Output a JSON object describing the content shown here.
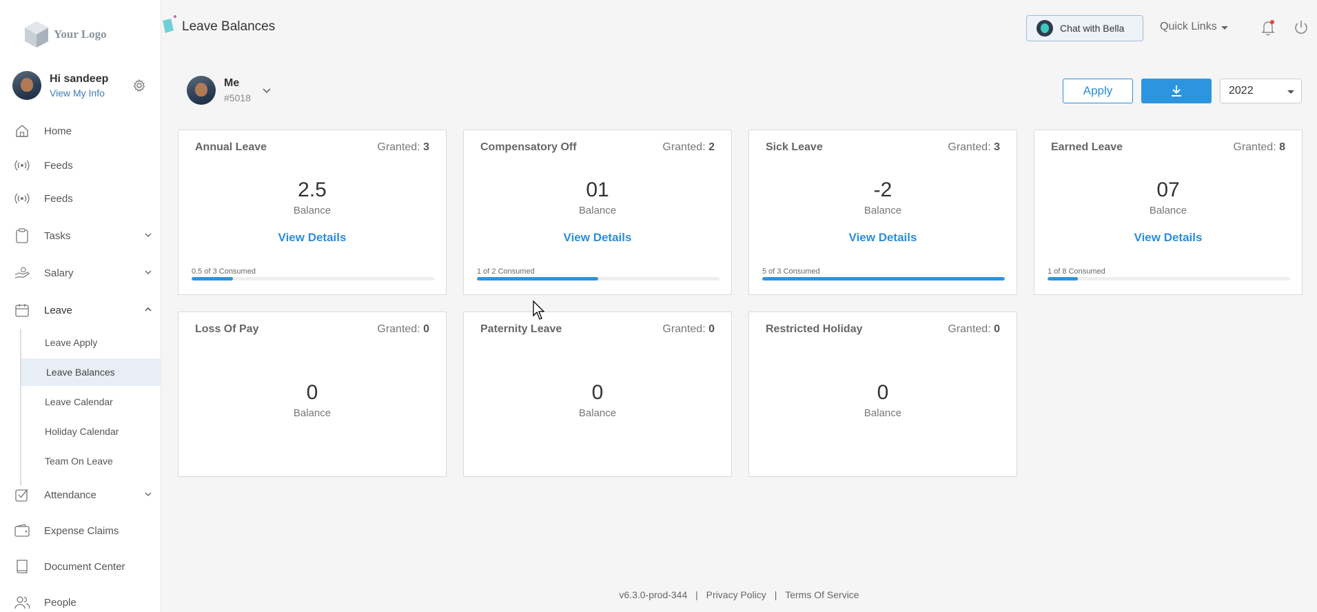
{
  "logo": {
    "text": "Your Logo"
  },
  "user": {
    "greeting": "Hi sandeep",
    "link": "View My Info"
  },
  "nav": [
    {
      "label": "Home",
      "icon": "home-icon"
    },
    {
      "label": "Feeds",
      "icon": "broadcast-icon"
    },
    {
      "label": "Feeds",
      "icon": "broadcast-icon"
    },
    {
      "label": "Tasks",
      "icon": "clipboard-icon"
    },
    {
      "label": "Salary",
      "icon": "hand-money-icon"
    },
    {
      "label": "Leave",
      "icon": "calendar-icon"
    },
    {
      "label": "Attendance",
      "icon": "checkbox-icon"
    },
    {
      "label": "Expense Claims",
      "icon": "wallet-icon"
    },
    {
      "label": "Document Center",
      "icon": "book-icon"
    },
    {
      "label": "People",
      "icon": "people-icon"
    }
  ],
  "leave_sub": [
    "Leave Apply",
    "Leave Balances",
    "Leave Calendar",
    "Holiday Calendar",
    "Team On Leave"
  ],
  "header": {
    "title": "Leave Balances",
    "chat": "Chat with Bella",
    "quick_links": "Quick Links"
  },
  "employee": {
    "name": "Me",
    "id": "#5018"
  },
  "actions": {
    "apply": "Apply",
    "year": "2022"
  },
  "granted_label": "Granted:",
  "balance_label": "Balance",
  "details_label": "View Details",
  "cards": [
    {
      "title": "Annual Leave",
      "granted": "3",
      "balance": "2.5",
      "consumed": "0.5 of 3 Consumed",
      "consumed_fraction": 0.17,
      "details": true
    },
    {
      "title": "Compensatory Off",
      "granted": "2",
      "balance": "01",
      "consumed": "1 of 2 Consumed",
      "consumed_fraction": 0.5,
      "details": true
    },
    {
      "title": "Sick Leave",
      "granted": "3",
      "balance": "-2",
      "consumed": "5 of 3 Consumed",
      "consumed_fraction": 1.0,
      "details": true
    },
    {
      "title": "Earned Leave",
      "granted": "8",
      "balance": "07",
      "consumed": "1 of 8 Consumed",
      "consumed_fraction": 0.125,
      "details": true
    },
    {
      "title": "Loss Of Pay",
      "granted": "0",
      "balance": "0",
      "details": false
    },
    {
      "title": "Paternity Leave",
      "granted": "0",
      "balance": "0",
      "details": false
    },
    {
      "title": "Restricted Holiday",
      "granted": "0",
      "balance": "0",
      "details": false
    }
  ],
  "footer": {
    "version": "v6.3.0-prod-344",
    "privacy": "Privacy Policy",
    "terms": "Terms Of Service",
    "separator": "|"
  },
  "colors": {
    "accent": "#2b95e0",
    "link": "#3d7bb6",
    "active_bg": "#e8eef6"
  }
}
